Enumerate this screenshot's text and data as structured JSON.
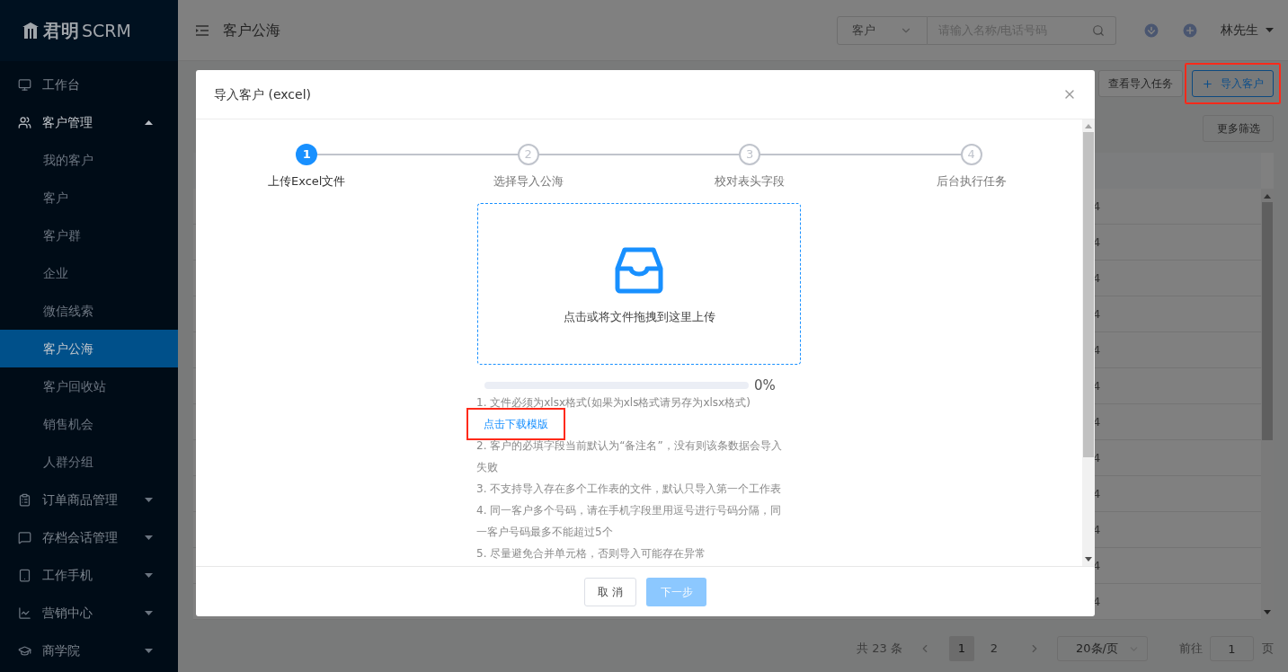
{
  "sidebar": {
    "logo": {
      "brand": "君明",
      "suffix": "SCRM"
    },
    "menu": [
      {
        "label": "工作台",
        "kind": "link"
      },
      {
        "label": "客户管理",
        "kind": "group",
        "expanded": true,
        "children": [
          {
            "label": "我的客户",
            "selected": false
          },
          {
            "label": "客户",
            "selected": false
          },
          {
            "label": "客户群",
            "selected": false
          },
          {
            "label": "企业",
            "selected": false
          },
          {
            "label": "微信线索",
            "selected": false
          },
          {
            "label": "客户公海",
            "selected": true
          },
          {
            "label": "客户回收站",
            "selected": false
          },
          {
            "label": "销售机会",
            "selected": false
          },
          {
            "label": "人群分组",
            "selected": false
          }
        ]
      },
      {
        "label": "订单商品管理",
        "kind": "group",
        "expanded": false
      },
      {
        "label": "存档会话管理",
        "kind": "group",
        "expanded": false
      },
      {
        "label": "工作手机",
        "kind": "group",
        "expanded": false
      },
      {
        "label": "营销中心",
        "kind": "group",
        "expanded": false
      },
      {
        "label": "商学院",
        "kind": "group",
        "expanded": false
      }
    ]
  },
  "topbar": {
    "title": "客户公海",
    "search": {
      "scope": "客户",
      "placeholder": "请输入名称/电话号码"
    },
    "user": "林先生"
  },
  "toolbar": {
    "buttons": [
      {
        "label": "查看导入任务",
        "kind": "plain",
        "highlighted": false
      },
      {
        "label": "导入客户",
        "kind": "primary",
        "highlighted": true
      }
    ],
    "filter_button": "更多筛选"
  },
  "table": {
    "rows": [
      {
        "cell": "4"
      },
      {
        "cell": "4"
      },
      {
        "cell": "4"
      },
      {
        "cell": "4"
      },
      {
        "cell": "4"
      },
      {
        "cell": "4"
      },
      {
        "cell": "4"
      },
      {
        "cell": "4"
      },
      {
        "cell": "4"
      },
      {
        "cell": "4"
      },
      {
        "cell": "4"
      },
      {
        "cell": "4"
      }
    ]
  },
  "pagination": {
    "total": "共 23 条",
    "pages": [
      {
        "label": "1",
        "selected": true
      },
      {
        "label": "2",
        "selected": false
      }
    ],
    "page_size": "20条/页",
    "goto_label": "前往",
    "goto_value": "1",
    "page_suffix": "页"
  },
  "modal": {
    "title": "导入客户 (excel)",
    "steps": [
      {
        "number": "1",
        "label": "上传Excel文件",
        "active": true
      },
      {
        "number": "2",
        "label": "选择导入公海",
        "active": false
      },
      {
        "number": "3",
        "label": "校对表头字段",
        "active": false
      },
      {
        "number": "4",
        "label": "后台执行任务",
        "active": false
      }
    ],
    "upload_hint": "点击或将文件拖拽到这里上传",
    "progress": {
      "level": 0,
      "reading": "0%"
    },
    "notes": [
      {
        "kind": "note",
        "text": "1. 文件必须为xlsx格式(如果为xls格式请另存为xlsx格式)"
      },
      {
        "kind": "link",
        "text": "点击下载模版",
        "highlighted": true
      },
      {
        "kind": "note",
        "text": "2. 客户的必填字段当前默认为“备注名”，没有则该条数据会导入失败"
      },
      {
        "kind": "note",
        "text": "3. 不支持导入存在多个工作表的文件，默认只导入第一个工作表"
      },
      {
        "kind": "note",
        "text": "4. 同一客户多个号码，请在手机字段里用逗号进行号码分隔，同一客户号码最多不能超过5个"
      },
      {
        "kind": "note",
        "text": "5. 尽量避免合并单元格，否则导入可能存在异常"
      }
    ],
    "cancel": "取 消",
    "next": {
      "label": "下一步",
      "disabled": true
    }
  }
}
